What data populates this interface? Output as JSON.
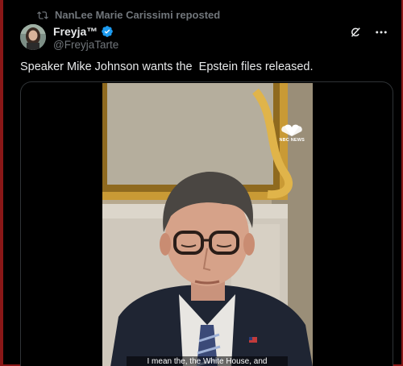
{
  "repost": {
    "text": "NanLee Marie Carissimi reposted"
  },
  "author": {
    "name": "Freyja™",
    "handle": "@FreyjaTarte"
  },
  "tweet": {
    "text": "Speaker Mike Johnson wants the  Epstein files released."
  },
  "video": {
    "network_label": "NBC NEWS",
    "caption": "I mean the, the White House, and"
  },
  "icons": {
    "repost": "repost-icon",
    "verified": "verified-badge-icon",
    "grok": "grok-icon",
    "more": "more-options-icon",
    "network_logo": "nbc-peacock-logo"
  },
  "colors": {
    "background": "#000000",
    "text": "#e7e9ea",
    "muted": "#71767b",
    "verified": "#1d9bf0",
    "frame": "#8a1717"
  }
}
